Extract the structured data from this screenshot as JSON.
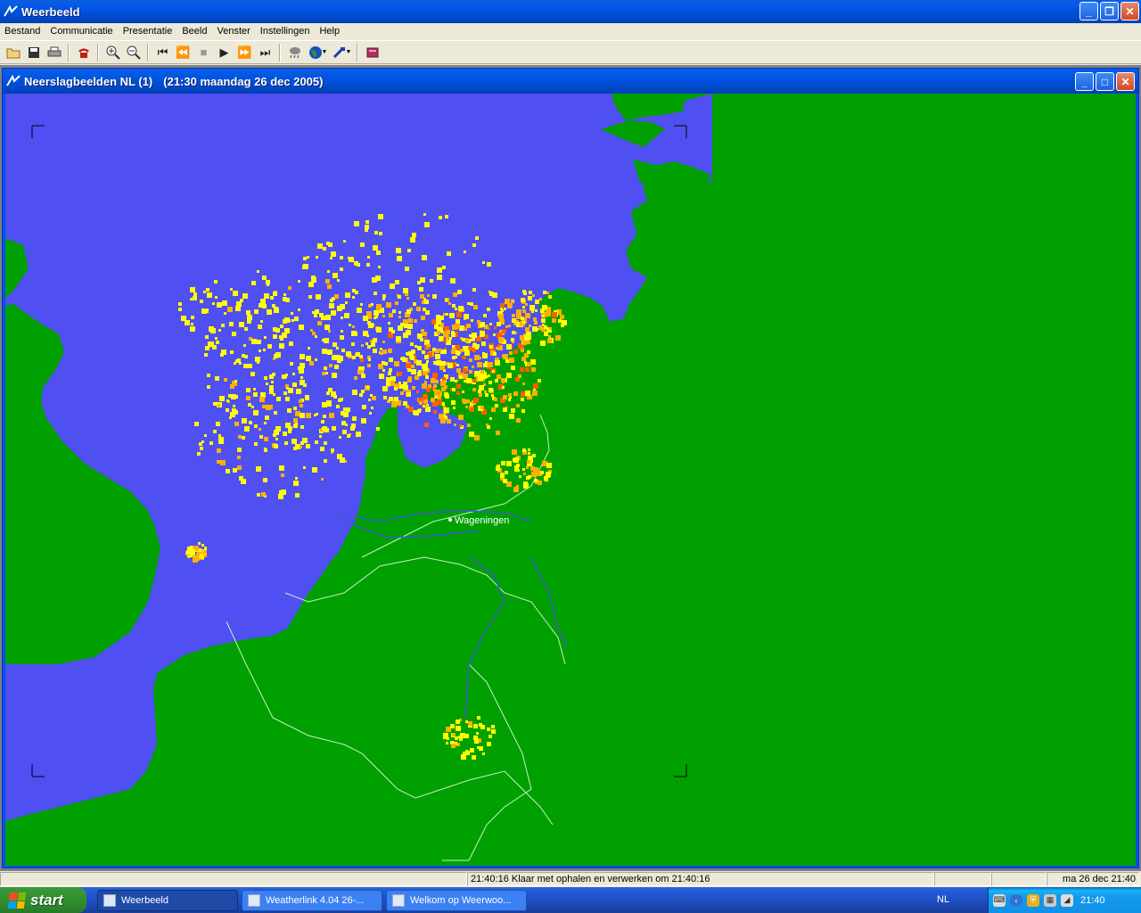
{
  "app": {
    "title": "Weerbeeld",
    "icon": "weerbeeld-app-icon"
  },
  "menu": [
    "Bestand",
    "Communicatie",
    "Presentatie",
    "Beeld",
    "Venster",
    "Instellingen",
    "Help"
  ],
  "toolbar": {
    "buttons": [
      "open-icon",
      "save-icon",
      "print-icon",
      "phone-icon",
      "zoom-in-icon",
      "zoom-out-icon",
      "first-frame-icon",
      "previous-frame-icon",
      "stop-icon",
      "play-icon",
      "next-frame-icon",
      "last-frame-icon",
      "rain-icon",
      "globe-icon",
      "satellite-icon",
      "book-icon"
    ]
  },
  "child_window": {
    "title": "Neerslagbeelden NL (1)",
    "timestamp": "(21:30 maandag 26 dec 2005)",
    "map": {
      "city_label": "Wageningen",
      "colors": {
        "sea": "#4f4ff2",
        "land": "#00a000",
        "precip_light": "#ffff00",
        "precip_medium": "#ffb000",
        "precip_heavy": "#ff6000"
      }
    }
  },
  "statusbar": {
    "message": "21:40:16 Klaar met ophalen en verwerken om 21:40:16",
    "date": "ma 26 dec 21:40"
  },
  "taskbar": {
    "start_label": "start",
    "tasks": [
      "Weerbeeld",
      "Weatherlink 4.04  26-...",
      "Welkom op Weerwoo..."
    ],
    "language": "NL",
    "clock": "21:40"
  }
}
